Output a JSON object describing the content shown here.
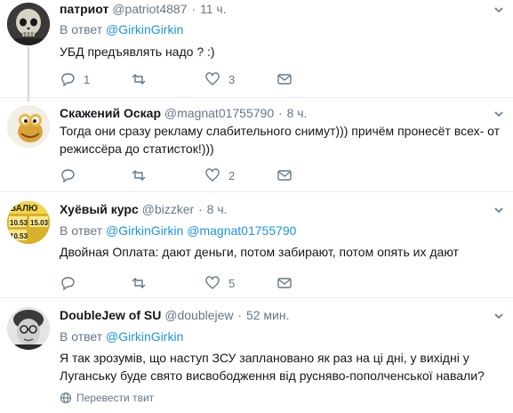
{
  "tweets": [
    {
      "name": "патриот",
      "handle": "@patriot4887",
      "time": "11 ч.",
      "reply_prefix": "В ответ",
      "reply_mentions": [
        "@GirkinGirkin"
      ],
      "text": "УБД  предъявлять надо ? :)",
      "replies": "1",
      "retweets": "",
      "likes": "3",
      "avatar": "skull-avatar"
    },
    {
      "name": "Скажений Оскар",
      "handle": "@magnat01755790",
      "time": "8 ч.",
      "text": "Тогда они сразу рекламу слабительного снимут))) причём пронесёт всех- от режиссёра до статисток!)))",
      "replies": "",
      "retweets": "",
      "likes": "2",
      "avatar": "cartoon-lizard-avatar"
    },
    {
      "name": "Хуёвый курс",
      "handle": "@bizzker",
      "time": "8 ч.",
      "reply_prefix": "В ответ",
      "reply_mentions": [
        "@GirkinGirkin",
        "@magnat01755790"
      ],
      "text": "Двойная Оплата: дают деньги, потом забирают, потом опять их дают",
      "replies": "",
      "retweets": "",
      "likes": "5",
      "avatar": "exchange-board-avatar",
      "avatar_texts": [
        "ВАЛЮ",
        "10.53",
        "15.03",
        "10.53"
      ]
    },
    {
      "name": "DoubleJew of SU",
      "handle": "@doublejew",
      "time": "52 мин.",
      "reply_prefix": "В ответ",
      "reply_mentions": [
        "@GirkinGirkin"
      ],
      "text": "Я так зрозумів, що наступ ЗСУ заплановано як раз на ці дні, у вихідні у Луганську буде свято висвободження від русняво-пополченської навали?",
      "translate": "Перевести твит",
      "avatar": "bw-face-avatar"
    }
  ],
  "colors": {
    "link": "#1b95e0",
    "secondary": "#657786",
    "separator": "#e6ecf0",
    "thread": "#ccd6dd"
  }
}
